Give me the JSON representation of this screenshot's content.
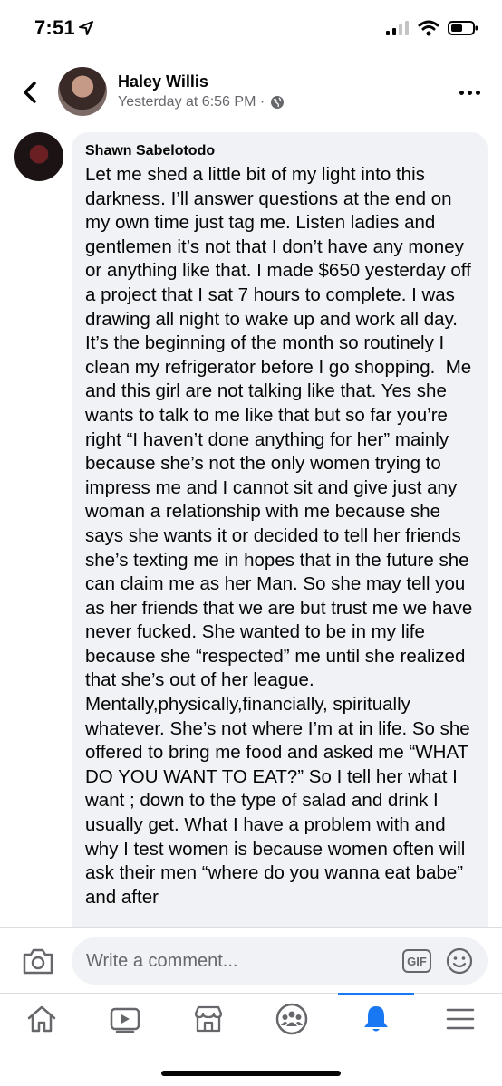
{
  "status_bar": {
    "time": "7:51"
  },
  "header": {
    "name": "Haley Willis",
    "timestamp": "Yesterday at 6:56 PM ·"
  },
  "comment": {
    "author": "Shawn Sabelotodo",
    "text": "Let me shed a little bit of my light into this darkness. I’ll answer questions at the end on my own time just tag me. Listen ladies and gentlemen it’s not that I don’t have any money or anything like that. I made $650 yesterday off a project that I sat 7 hours to complete. I was drawing all night to wake up and work all day. It’s the beginning of the month so routinely I clean my refrigerator before I go shopping.  Me and this girl are not talking like that. Yes she wants to talk to me like that but so far you’re right “I haven’t done anything for her” mainly because she’s not the only women trying to impress me and I cannot sit and give just any woman a relationship with me because she says she wants it or decided to tell her friends she’s texting me in hopes that in the future she can claim me as her Man. So she may tell you as her friends that we are but trust me we have never fucked. She wanted to be in my life because she “respected” me until she realized that she’s out of her league. Mentally,physically,financially, spiritually whatever. She’s not where I’m at in life. So she offered to bring me food and asked me “WHAT DO YOU WANT TO EAT?” So I tell her what I want ; down to the type of salad and drink I usually get. What I have a problem with and why I test women is because women often will ask their men “where do you wanna eat babe” and after"
  },
  "composer": {
    "placeholder": "Write a comment...",
    "gif_label": "GIF"
  },
  "bottom_nav": {
    "items": [
      "home-icon",
      "watch-icon",
      "marketplace-icon",
      "groups-icon",
      "notifications-icon",
      "menu-icon"
    ],
    "active": "notifications-icon"
  },
  "colors": {
    "accent": "#1877f2",
    "bubble": "#f0f2f5",
    "secondary_text": "#65676b"
  }
}
